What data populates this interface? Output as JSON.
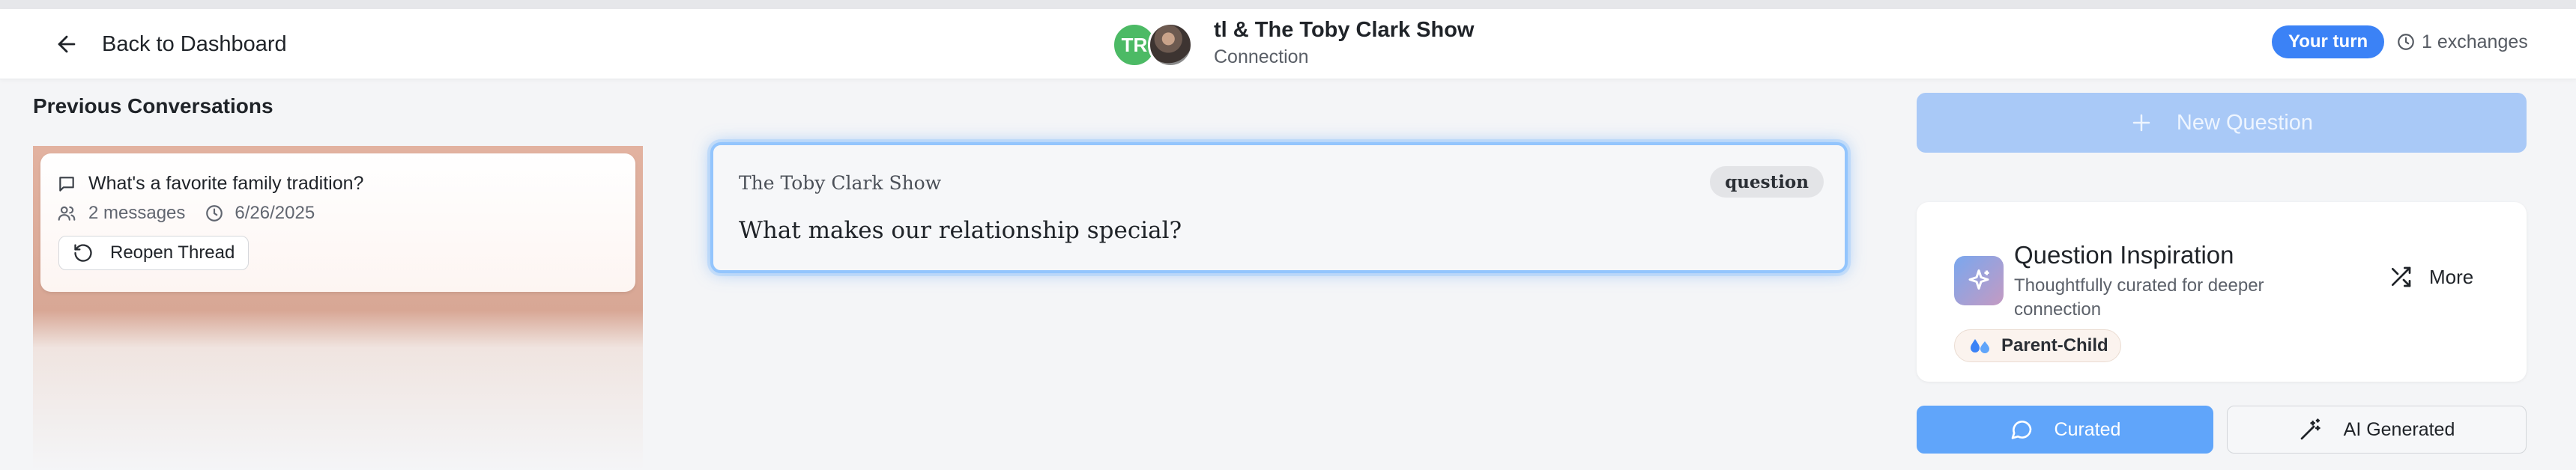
{
  "header": {
    "back_label": "Back to Dashboard",
    "title": "tl & The Toby Clark Show",
    "subtitle": "Connection",
    "avatar_initials": "TR",
    "turn_badge": "Your turn",
    "exchanges": "1 exchanges"
  },
  "sidebar": {
    "title": "Previous Conversations",
    "threads": [
      {
        "question": "What's a favorite family tradition?",
        "messages": "2 messages",
        "date": "6/26/2025",
        "reopen_label": "Reopen Thread"
      }
    ]
  },
  "question_card": {
    "author": "The Toby Clark Show",
    "type_badge": "question",
    "text": "What makes our relationship special?"
  },
  "right_panel": {
    "new_question_label": "New Question",
    "inspiration": {
      "title": "Question Inspiration",
      "description": "Thoughtfully curated for deeper connection",
      "more_label": "More",
      "tag": "Parent-Child"
    },
    "tabs": {
      "curated": "Curated",
      "ai_generated": "AI Generated"
    }
  },
  "colors": {
    "accent": "#3b82f6",
    "curated_tab": "#60a5fa",
    "new_question_button": "#a9c9f7",
    "avatar_green": "#4cba65"
  }
}
